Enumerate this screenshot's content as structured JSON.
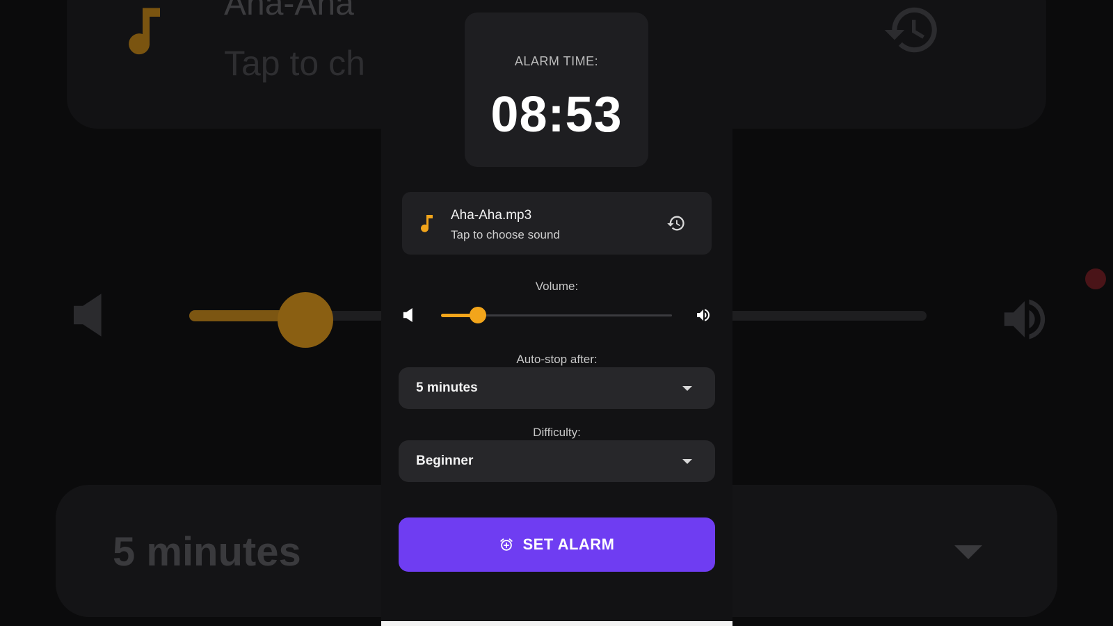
{
  "alarm": {
    "label": "ALARM TIME:",
    "time": "08:53"
  },
  "sound": {
    "file_name": "Aha-Aha.mp3",
    "hint": "Tap to choose sound",
    "icon": "music-note-icon",
    "history_icon": "history-icon"
  },
  "volume": {
    "label": "Volume:",
    "level": 0.16,
    "min_icon": "volume-low-icon",
    "max_icon": "volume-high-icon"
  },
  "auto_stop": {
    "label": "Auto-stop after:",
    "selected": "5 minutes"
  },
  "difficulty": {
    "label": "Difficulty:",
    "selected": "Beginner"
  },
  "actions": {
    "set_alarm_label": "SET ALARM",
    "set_alarm_icon": "alarm-add-icon"
  },
  "background": {
    "song_fragment": "Aha-Aha",
    "hint_fragment": "Tap to ch",
    "minutes_fragment": "5 minutes"
  },
  "colors": {
    "accent": "#f2a51b",
    "primary": "#6f3df2",
    "surface": "#121214",
    "card": "#202023"
  }
}
